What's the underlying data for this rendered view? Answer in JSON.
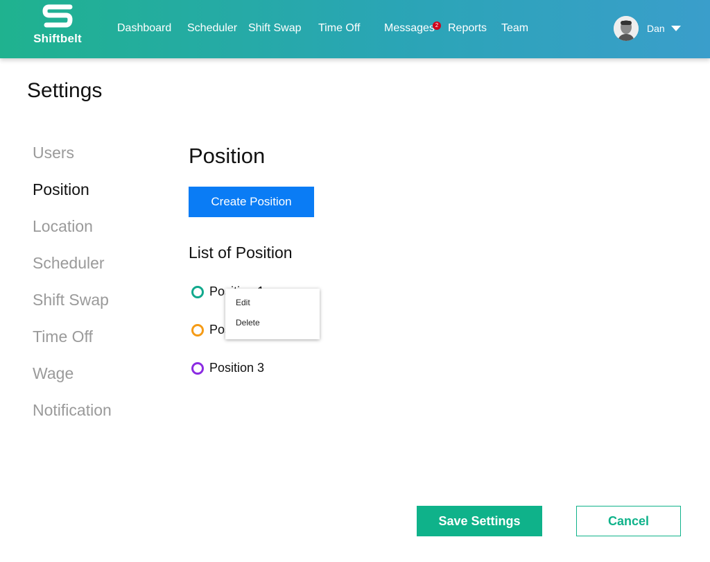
{
  "header": {
    "brand": "Shiftbelt",
    "nav": [
      "Dashboard",
      "Scheduler",
      "Shift Swap",
      "Time Off",
      "Messages",
      "Reports",
      "Team"
    ],
    "messages_badge": "2",
    "user_name": "Dan",
    "colors": {
      "gradient_start": "#1fb28f",
      "gradient_end": "#3a9ecb",
      "badge": "#d0021b"
    }
  },
  "page": {
    "title": "Settings"
  },
  "sidebar": {
    "items": [
      "Users",
      "Position",
      "Location",
      "Scheduler",
      "Shift Swap",
      "Time Off",
      "Wage",
      "Notification"
    ],
    "active": "Position"
  },
  "main": {
    "title": "Position",
    "create_button": "Create Position",
    "list_title": "List of Position",
    "positions": [
      {
        "label": "Position 1",
        "color": "#12a98d"
      },
      {
        "label": "Position 2",
        "color": "#f59b16"
      },
      {
        "label": "Position 3",
        "color": "#8b2be2"
      }
    ]
  },
  "context_menu": {
    "items": [
      "Edit",
      "Delete"
    ]
  },
  "footer": {
    "save_button": "Save Settings",
    "cancel_button": "Cancel",
    "colors": {
      "primary": "#0fb28a",
      "create": "#0a7cf5"
    }
  }
}
